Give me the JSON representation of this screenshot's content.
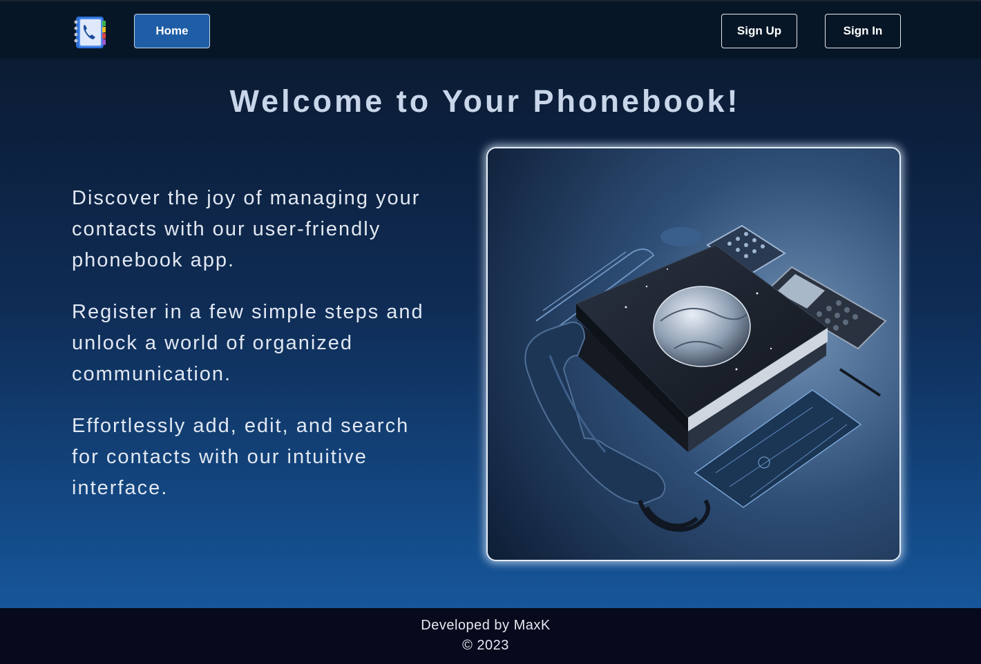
{
  "nav": {
    "logo_icon": "phonebook-icon",
    "home_label": "Home",
    "signup_label": "Sign Up",
    "signin_label": "Sign In"
  },
  "main": {
    "title": "Welcome to Your Phonebook!",
    "paragraphs": [
      "Discover the joy of managing your contacts with our user-friendly phonebook app.",
      "Register in a few simple steps and unlock a world of organized communication.",
      "Effortlessly add, edit, and search for contacts with our intuitive interface."
    ],
    "hero_image": "phonebook-illustration"
  },
  "footer": {
    "credit": "Developed by MaxK",
    "copyright": "© 2023"
  },
  "colors": {
    "header_bg": "#071626",
    "home_button_bg": "#1f5ea6",
    "footer_bg": "#060a1c",
    "title_color": "#c9d6ea"
  }
}
